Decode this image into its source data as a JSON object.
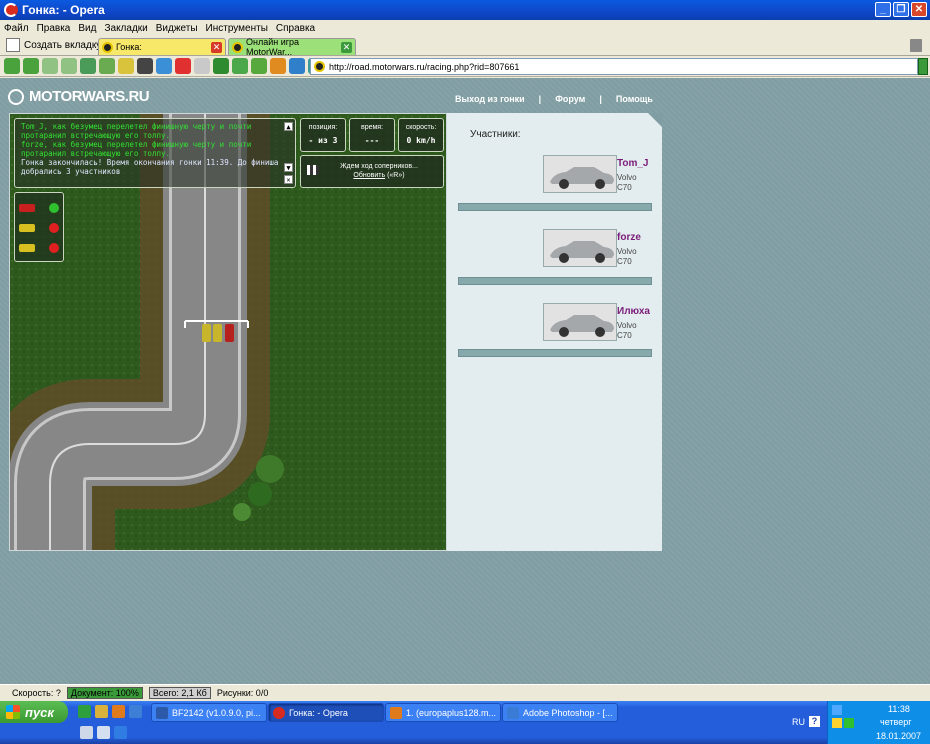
{
  "window": {
    "title": "Гонка: - Opera"
  },
  "menu": [
    "Файл",
    "Правка",
    "Вид",
    "Закладки",
    "Виджеты",
    "Инструменты",
    "Справка"
  ],
  "tabs": {
    "new_tab": "Создать вкладку",
    "items": [
      {
        "label": "Гонка:"
      },
      {
        "label": "Онлайн игра MotorWar..."
      }
    ]
  },
  "address": {
    "url": "http://road.motorwars.ru/racing.php?rid=807661"
  },
  "site": {
    "logo": "MOTORWARS.RU",
    "nav": [
      "Выход из гонки",
      "|",
      "Форум",
      "|",
      "Помощь"
    ]
  },
  "game": {
    "chat": [
      {
        "text": "Tom_J, как безумец перелетел финишную черту и почти",
        "style": "g"
      },
      {
        "text": "протаранил встречающую его толпу.",
        "style": "g"
      },
      {
        "text": "forze, как безумец перелетел финишную черту и почти",
        "style": "g"
      },
      {
        "text": "протаранил встречающую его толпу.",
        "style": "g"
      },
      {
        "text": "Гонка закончилась! Время окончания гонки 11:39. До финиша",
        "style": "w"
      },
      {
        "text": "добрались 3 участников",
        "style": "w"
      }
    ],
    "stats": [
      {
        "label": "позиция:",
        "value": "- из 3"
      },
      {
        "label": "время:",
        "value": "---"
      },
      {
        "label": "скорость:",
        "value": "0 km/h"
      }
    ],
    "waiting": "Ждем ход соперников...",
    "refresh": "Обновить",
    "refresh_key": "(«R»)",
    "lights": [
      {
        "car_color": "#c8201e",
        "light": "#2fbf2f"
      },
      {
        "car_color": "#d8c021",
        "light": "#e02020"
      },
      {
        "car_color": "#d8c021",
        "light": "#e02020"
      }
    ]
  },
  "participants": {
    "heading": "Участники:",
    "list": [
      {
        "name": "Tom_J",
        "make": "Volvo",
        "model": "C70"
      },
      {
        "name": "forze",
        "make": "Volvo",
        "model": "C70"
      },
      {
        "name": "Илюха",
        "make": "Volvo",
        "model": "C70"
      }
    ]
  },
  "status": {
    "speed": "Скорость:  ?",
    "document": "Документ:    100%",
    "total": "Всего:   2,1 Кб",
    "images": "Рисунки:   0/0"
  },
  "taskbar": {
    "start": "пуск",
    "tasks": [
      "BF2142 (v1.0.9.0, pi...",
      "Гонка: - Opera",
      "1. (europaplus128.m...",
      "Adobe Photoshop - [..."
    ],
    "lang": "RU",
    "time": "11:38",
    "day": "четверг",
    "date": "18.01.2007"
  }
}
